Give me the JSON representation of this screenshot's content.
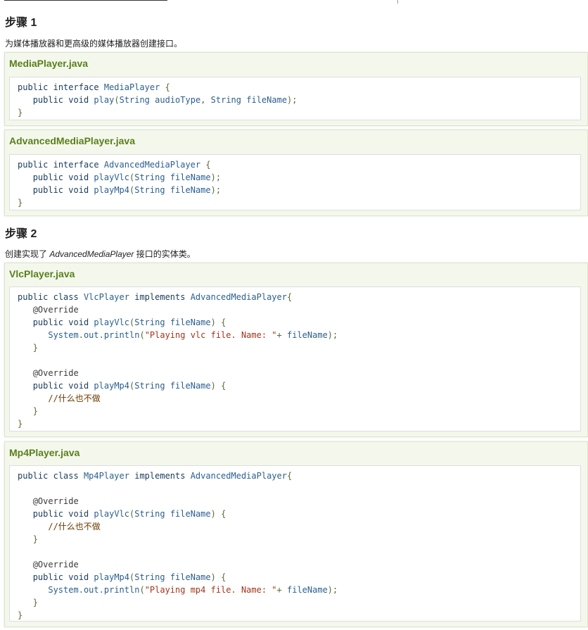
{
  "colors": {
    "keyword": "#1a3c5c",
    "type": "#2a5f8f",
    "string": "#a0361b",
    "plain": "#333333",
    "punct": "#556b2f",
    "annotation": "#3a3a3a",
    "comment": "#6b3a00",
    "title": "#5a7f1c"
  },
  "step1": {
    "heading": "步骤 1",
    "description": "为媒体播放器和更高级的媒体播放器创建接口。"
  },
  "step2": {
    "heading": "步骤 2",
    "desc_before": "创建实现了 ",
    "desc_em": "AdvancedMediaPlayer",
    "desc_after": " 接口的实体类。"
  },
  "examples": [
    {
      "title": "MediaPlayer.java",
      "code": [
        [
          [
            "kw",
            "public"
          ],
          [
            "pl",
            " "
          ],
          [
            "kw",
            "interface"
          ],
          [
            "pl",
            " "
          ],
          [
            "ty",
            "MediaPlayer"
          ],
          [
            "pl",
            " "
          ],
          [
            "pu",
            "{"
          ]
        ],
        [
          [
            "pl",
            "   "
          ],
          [
            "kw",
            "public"
          ],
          [
            "pl",
            " "
          ],
          [
            "kw",
            "void"
          ],
          [
            "pl",
            " "
          ],
          [
            "ty",
            "play"
          ],
          [
            "pu",
            "("
          ],
          [
            "ty",
            "String"
          ],
          [
            "pl",
            " "
          ],
          [
            "ty",
            "audioType"
          ],
          [
            "pu",
            ","
          ],
          [
            "pl",
            " "
          ],
          [
            "ty",
            "String"
          ],
          [
            "pl",
            " "
          ],
          [
            "ty",
            "fileName"
          ],
          [
            "pu",
            ");"
          ]
        ],
        [
          [
            "pu",
            "}"
          ]
        ]
      ]
    },
    {
      "title": "AdvancedMediaPlayer.java",
      "code": [
        [
          [
            "kw",
            "public"
          ],
          [
            "pl",
            " "
          ],
          [
            "kw",
            "interface"
          ],
          [
            "pl",
            " "
          ],
          [
            "ty",
            "AdvancedMediaPlayer"
          ],
          [
            "pl",
            " "
          ],
          [
            "pu",
            "{"
          ]
        ],
        [
          [
            "pl",
            "   "
          ],
          [
            "kw",
            "public"
          ],
          [
            "pl",
            " "
          ],
          [
            "kw",
            "void"
          ],
          [
            "pl",
            " "
          ],
          [
            "ty",
            "playVlc"
          ],
          [
            "pu",
            "("
          ],
          [
            "ty",
            "String"
          ],
          [
            "pl",
            " "
          ],
          [
            "ty",
            "fileName"
          ],
          [
            "pu",
            ");"
          ]
        ],
        [
          [
            "pl",
            "   "
          ],
          [
            "kw",
            "public"
          ],
          [
            "pl",
            " "
          ],
          [
            "kw",
            "void"
          ],
          [
            "pl",
            " "
          ],
          [
            "ty",
            "playMp4"
          ],
          [
            "pu",
            "("
          ],
          [
            "ty",
            "String"
          ],
          [
            "pl",
            " "
          ],
          [
            "ty",
            "fileName"
          ],
          [
            "pu",
            ");"
          ]
        ],
        [
          [
            "pu",
            "}"
          ]
        ]
      ]
    },
    {
      "title": "VlcPlayer.java",
      "code": [
        [
          [
            "kw",
            "public"
          ],
          [
            "pl",
            " "
          ],
          [
            "kw",
            "class"
          ],
          [
            "pl",
            " "
          ],
          [
            "ty",
            "VlcPlayer"
          ],
          [
            "pl",
            " "
          ],
          [
            "kw",
            "implements"
          ],
          [
            "pl",
            " "
          ],
          [
            "ty",
            "AdvancedMediaPlayer"
          ],
          [
            "pu",
            "{"
          ]
        ],
        [
          [
            "pl",
            "   "
          ],
          [
            "an",
            "@Override"
          ]
        ],
        [
          [
            "pl",
            "   "
          ],
          [
            "kw",
            "public"
          ],
          [
            "pl",
            " "
          ],
          [
            "kw",
            "void"
          ],
          [
            "pl",
            " "
          ],
          [
            "ty",
            "playVlc"
          ],
          [
            "pu",
            "("
          ],
          [
            "ty",
            "String"
          ],
          [
            "pl",
            " "
          ],
          [
            "ty",
            "fileName"
          ],
          [
            "pu",
            ")"
          ],
          [
            "pl",
            " "
          ],
          [
            "pu",
            "{"
          ]
        ],
        [
          [
            "pl",
            "      "
          ],
          [
            "ty",
            "System"
          ],
          [
            "pu",
            "."
          ],
          [
            "ty",
            "out"
          ],
          [
            "pu",
            "."
          ],
          [
            "ty",
            "println"
          ],
          [
            "pu",
            "("
          ],
          [
            "st",
            "\"Playing vlc file. Name: \""
          ],
          [
            "pu",
            "+"
          ],
          [
            "pl",
            " "
          ],
          [
            "ty",
            "fileName"
          ],
          [
            "pu",
            ");"
          ]
        ],
        [
          [
            "pl",
            "   "
          ],
          [
            "pu",
            "}"
          ]
        ],
        [
          [
            "pl",
            " "
          ]
        ],
        [
          [
            "pl",
            "   "
          ],
          [
            "an",
            "@Override"
          ]
        ],
        [
          [
            "pl",
            "   "
          ],
          [
            "kw",
            "public"
          ],
          [
            "pl",
            " "
          ],
          [
            "kw",
            "void"
          ],
          [
            "pl",
            " "
          ],
          [
            "ty",
            "playMp4"
          ],
          [
            "pu",
            "("
          ],
          [
            "ty",
            "String"
          ],
          [
            "pl",
            " "
          ],
          [
            "ty",
            "fileName"
          ],
          [
            "pu",
            ")"
          ],
          [
            "pl",
            " "
          ],
          [
            "pu",
            "{"
          ]
        ],
        [
          [
            "pl",
            "      "
          ],
          [
            "cm",
            "//什么也不做"
          ]
        ],
        [
          [
            "pl",
            "   "
          ],
          [
            "pu",
            "}"
          ]
        ],
        [
          [
            "pu",
            "}"
          ]
        ]
      ]
    },
    {
      "title": "Mp4Player.java",
      "code": [
        [
          [
            "kw",
            "public"
          ],
          [
            "pl",
            " "
          ],
          [
            "kw",
            "class"
          ],
          [
            "pl",
            " "
          ],
          [
            "ty",
            "Mp4Player"
          ],
          [
            "pl",
            " "
          ],
          [
            "kw",
            "implements"
          ],
          [
            "pl",
            " "
          ],
          [
            "ty",
            "AdvancedMediaPlayer"
          ],
          [
            "pu",
            "{"
          ]
        ],
        [
          [
            "pl",
            " "
          ]
        ],
        [
          [
            "pl",
            "   "
          ],
          [
            "an",
            "@Override"
          ]
        ],
        [
          [
            "pl",
            "   "
          ],
          [
            "kw",
            "public"
          ],
          [
            "pl",
            " "
          ],
          [
            "kw",
            "void"
          ],
          [
            "pl",
            " "
          ],
          [
            "ty",
            "playVlc"
          ],
          [
            "pu",
            "("
          ],
          [
            "ty",
            "String"
          ],
          [
            "pl",
            " "
          ],
          [
            "ty",
            "fileName"
          ],
          [
            "pu",
            ")"
          ],
          [
            "pl",
            " "
          ],
          [
            "pu",
            "{"
          ]
        ],
        [
          [
            "pl",
            "      "
          ],
          [
            "cm",
            "//什么也不做"
          ]
        ],
        [
          [
            "pl",
            "   "
          ],
          [
            "pu",
            "}"
          ]
        ],
        [
          [
            "pl",
            " "
          ]
        ],
        [
          [
            "pl",
            "   "
          ],
          [
            "an",
            "@Override"
          ]
        ],
        [
          [
            "pl",
            "   "
          ],
          [
            "kw",
            "public"
          ],
          [
            "pl",
            " "
          ],
          [
            "kw",
            "void"
          ],
          [
            "pl",
            " "
          ],
          [
            "ty",
            "playMp4"
          ],
          [
            "pu",
            "("
          ],
          [
            "ty",
            "String"
          ],
          [
            "pl",
            " "
          ],
          [
            "ty",
            "fileName"
          ],
          [
            "pu",
            ")"
          ],
          [
            "pl",
            " "
          ],
          [
            "pu",
            "{"
          ]
        ],
        [
          [
            "pl",
            "      "
          ],
          [
            "ty",
            "System"
          ],
          [
            "pu",
            "."
          ],
          [
            "ty",
            "out"
          ],
          [
            "pu",
            "."
          ],
          [
            "ty",
            "println"
          ],
          [
            "pu",
            "("
          ],
          [
            "st",
            "\"Playing mp4 file. Name: \""
          ],
          [
            "pu",
            "+"
          ],
          [
            "pl",
            " "
          ],
          [
            "ty",
            "fileName"
          ],
          [
            "pu",
            ");"
          ]
        ],
        [
          [
            "pl",
            "   "
          ],
          [
            "pu",
            "}"
          ]
        ],
        [
          [
            "pu",
            "}"
          ]
        ]
      ]
    }
  ]
}
